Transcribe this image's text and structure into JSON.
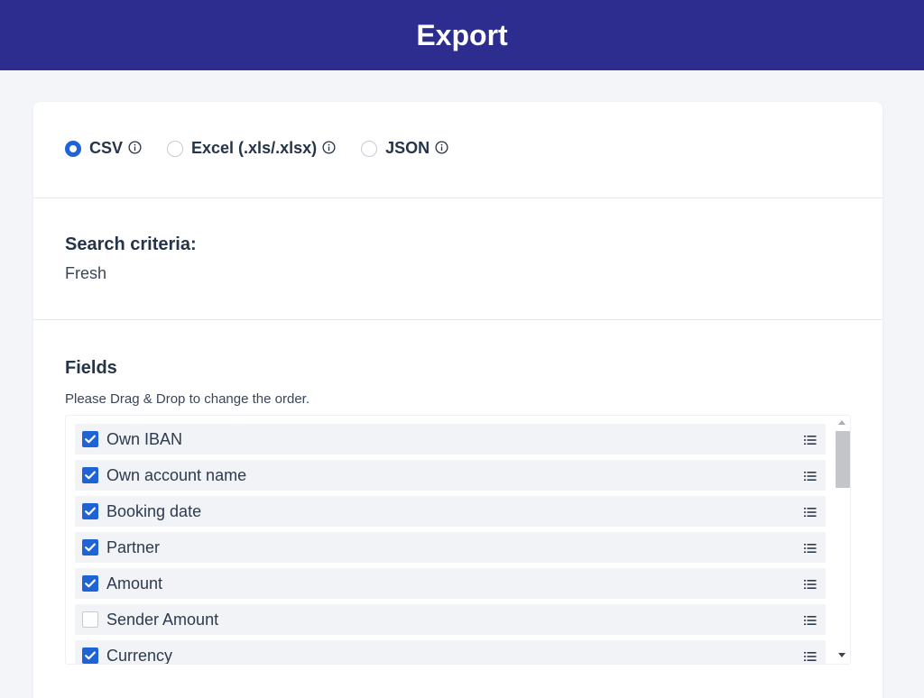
{
  "header": {
    "title": "Export"
  },
  "format": {
    "options": [
      {
        "label": "CSV",
        "checked": true
      },
      {
        "label": "Excel (.xls/.xlsx)",
        "checked": false
      },
      {
        "label": "JSON",
        "checked": false
      }
    ]
  },
  "criteria": {
    "title": "Search criteria:",
    "value": "Fresh"
  },
  "fields": {
    "title": "Fields",
    "hint": "Please Drag & Drop to change the order.",
    "items": [
      {
        "label": "Own IBAN",
        "checked": true
      },
      {
        "label": "Own account name",
        "checked": true
      },
      {
        "label": "Booking date",
        "checked": true
      },
      {
        "label": "Partner",
        "checked": true
      },
      {
        "label": "Amount",
        "checked": true
      },
      {
        "label": "Sender Amount",
        "checked": false
      },
      {
        "label": "Currency",
        "checked": true
      }
    ]
  },
  "colors": {
    "header_bg": "#2d2d8f",
    "accent": "#1f63d6",
    "page_bg": "#f3f5f8"
  }
}
